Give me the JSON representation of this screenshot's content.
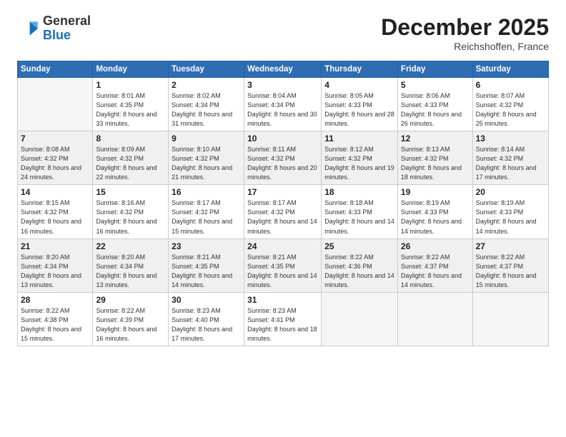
{
  "header": {
    "logo": {
      "general": "General",
      "blue": "Blue"
    },
    "title": "December 2025",
    "location": "Reichshoffen, France"
  },
  "days_of_week": [
    "Sunday",
    "Monday",
    "Tuesday",
    "Wednesday",
    "Thursday",
    "Friday",
    "Saturday"
  ],
  "weeks": [
    [
      {
        "day": "",
        "empty": true
      },
      {
        "day": "1",
        "sunrise": "8:01 AM",
        "sunset": "4:35 PM",
        "daylight": "8 hours and 33 minutes."
      },
      {
        "day": "2",
        "sunrise": "8:02 AM",
        "sunset": "4:34 PM",
        "daylight": "8 hours and 31 minutes."
      },
      {
        "day": "3",
        "sunrise": "8:04 AM",
        "sunset": "4:34 PM",
        "daylight": "8 hours and 30 minutes."
      },
      {
        "day": "4",
        "sunrise": "8:05 AM",
        "sunset": "4:33 PM",
        "daylight": "8 hours and 28 minutes."
      },
      {
        "day": "5",
        "sunrise": "8:06 AM",
        "sunset": "4:33 PM",
        "daylight": "8 hours and 26 minutes."
      },
      {
        "day": "6",
        "sunrise": "8:07 AM",
        "sunset": "4:32 PM",
        "daylight": "8 hours and 25 minutes."
      }
    ],
    [
      {
        "day": "7",
        "sunrise": "8:08 AM",
        "sunset": "4:32 PM",
        "daylight": "8 hours and 24 minutes."
      },
      {
        "day": "8",
        "sunrise": "8:09 AM",
        "sunset": "4:32 PM",
        "daylight": "8 hours and 22 minutes."
      },
      {
        "day": "9",
        "sunrise": "8:10 AM",
        "sunset": "4:32 PM",
        "daylight": "8 hours and 21 minutes."
      },
      {
        "day": "10",
        "sunrise": "8:11 AM",
        "sunset": "4:32 PM",
        "daylight": "8 hours and 20 minutes."
      },
      {
        "day": "11",
        "sunrise": "8:12 AM",
        "sunset": "4:32 PM",
        "daylight": "8 hours and 19 minutes."
      },
      {
        "day": "12",
        "sunrise": "8:13 AM",
        "sunset": "4:32 PM",
        "daylight": "8 hours and 18 minutes."
      },
      {
        "day": "13",
        "sunrise": "8:14 AM",
        "sunset": "4:32 PM",
        "daylight": "8 hours and 17 minutes."
      }
    ],
    [
      {
        "day": "14",
        "sunrise": "8:15 AM",
        "sunset": "4:32 PM",
        "daylight": "8 hours and 16 minutes."
      },
      {
        "day": "15",
        "sunrise": "8:16 AM",
        "sunset": "4:32 PM",
        "daylight": "8 hours and 16 minutes."
      },
      {
        "day": "16",
        "sunrise": "8:17 AM",
        "sunset": "4:32 PM",
        "daylight": "8 hours and 15 minutes."
      },
      {
        "day": "17",
        "sunrise": "8:17 AM",
        "sunset": "4:32 PM",
        "daylight": "8 hours and 14 minutes."
      },
      {
        "day": "18",
        "sunrise": "8:18 AM",
        "sunset": "4:33 PM",
        "daylight": "8 hours and 14 minutes."
      },
      {
        "day": "19",
        "sunrise": "8:19 AM",
        "sunset": "4:33 PM",
        "daylight": "8 hours and 14 minutes."
      },
      {
        "day": "20",
        "sunrise": "8:19 AM",
        "sunset": "4:33 PM",
        "daylight": "8 hours and 14 minutes."
      }
    ],
    [
      {
        "day": "21",
        "sunrise": "8:20 AM",
        "sunset": "4:34 PM",
        "daylight": "8 hours and 13 minutes."
      },
      {
        "day": "22",
        "sunrise": "8:20 AM",
        "sunset": "4:34 PM",
        "daylight": "8 hours and 13 minutes."
      },
      {
        "day": "23",
        "sunrise": "8:21 AM",
        "sunset": "4:35 PM",
        "daylight": "8 hours and 14 minutes."
      },
      {
        "day": "24",
        "sunrise": "8:21 AM",
        "sunset": "4:35 PM",
        "daylight": "8 hours and 14 minutes."
      },
      {
        "day": "25",
        "sunrise": "8:22 AM",
        "sunset": "4:36 PM",
        "daylight": "8 hours and 14 minutes."
      },
      {
        "day": "26",
        "sunrise": "8:22 AM",
        "sunset": "4:37 PM",
        "daylight": "8 hours and 14 minutes."
      },
      {
        "day": "27",
        "sunrise": "8:22 AM",
        "sunset": "4:37 PM",
        "daylight": "8 hours and 15 minutes."
      }
    ],
    [
      {
        "day": "28",
        "sunrise": "8:22 AM",
        "sunset": "4:38 PM",
        "daylight": "8 hours and 15 minutes."
      },
      {
        "day": "29",
        "sunrise": "8:22 AM",
        "sunset": "4:39 PM",
        "daylight": "8 hours and 16 minutes."
      },
      {
        "day": "30",
        "sunrise": "8:23 AM",
        "sunset": "4:40 PM",
        "daylight": "8 hours and 17 minutes."
      },
      {
        "day": "31",
        "sunrise": "8:23 AM",
        "sunset": "4:41 PM",
        "daylight": "8 hours and 18 minutes."
      },
      {
        "day": "",
        "empty": true
      },
      {
        "day": "",
        "empty": true
      },
      {
        "day": "",
        "empty": true
      }
    ]
  ],
  "labels": {
    "sunrise": "Sunrise:",
    "sunset": "Sunset:",
    "daylight": "Daylight:"
  }
}
